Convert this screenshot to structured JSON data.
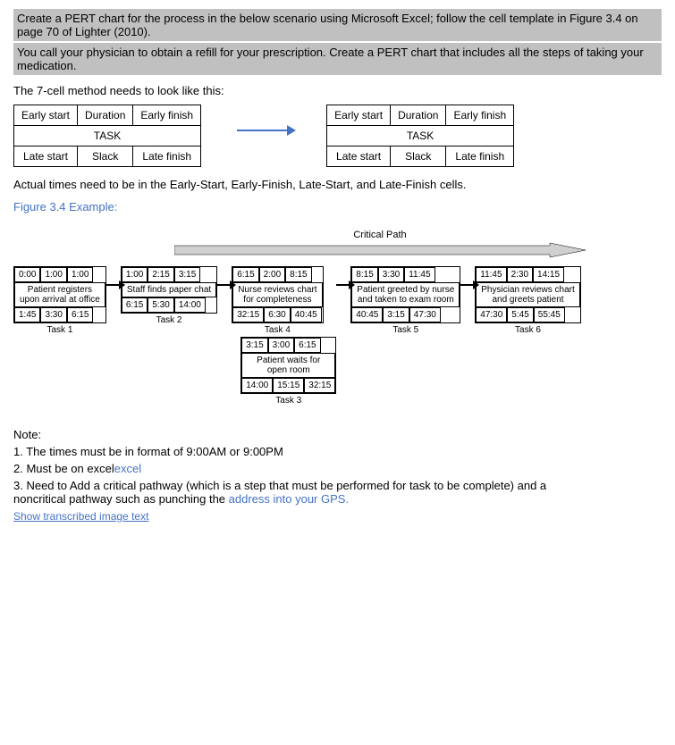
{
  "instructions": {
    "line1": "Create a PERT chart for the process in the below scenario using Microsoft Excel; follow the cell template in Figure 3.4 on page 70 of Lighter (2010).",
    "line2": "You call your physician to obtain a refill for your prescription. Create a PERT chart that includes all the steps of taking your medication."
  },
  "method_title": "The 7-cell method needs to look like this:",
  "left_table": {
    "top_row": [
      "Early start",
      "Duration",
      "Early finish"
    ],
    "middle": "TASK",
    "bottom_row": [
      "Late start",
      "Slack",
      "Late finish"
    ]
  },
  "right_table": {
    "top_row": [
      "Early start",
      "Duration",
      "Early finish"
    ],
    "middle": "TASK",
    "bottom_row": [
      "Late start",
      "Slack",
      "Late finish"
    ]
  },
  "actual_times_note": "Actual times need to be in the Early-Start, Early-Finish, Late-Start, and Late-Finish cells.",
  "figure_label": "Figure 3.4 Example:",
  "critical_path_label": "Critical Path",
  "tasks": [
    {
      "id": "task1",
      "label": "Task 1",
      "top": [
        "0:00",
        "1:00",
        "1:00"
      ],
      "middle": "Patient registers\nupon arrival at office",
      "bottom": [
        "1:45",
        "3:30",
        "6:15"
      ]
    },
    {
      "id": "task2",
      "label": "Task 2",
      "top": [
        "1:00",
        "2:15",
        "3:15"
      ],
      "middle": "Staff finds paper chat",
      "bottom": [
        "6:15",
        "5:30",
        "14:00"
      ]
    },
    {
      "id": "task3",
      "label": "Task 3",
      "top": [
        "3:15",
        "3:00",
        "6:15"
      ],
      "middle": "Patient waits for\nopen room",
      "bottom": [
        "14:00",
        "15:15",
        "32:15"
      ]
    },
    {
      "id": "task4",
      "label": "Task 4",
      "top": [
        "6:15",
        "2:00",
        "8:15"
      ],
      "middle": "Nurse reviews chart\nfor completeness",
      "bottom": [
        "32:15",
        "6:30",
        "40:45"
      ]
    },
    {
      "id": "task5",
      "label": "Task 5",
      "top": [
        "8:15",
        "3:30",
        "11:45"
      ],
      "middle": "Patient greeted by nurse\nand taken to exam room",
      "bottom": [
        "40:45",
        "3:15",
        "47:30"
      ]
    },
    {
      "id": "task6",
      "label": "Task 6",
      "top": [
        "11:45",
        "2:30",
        "14:15"
      ],
      "middle": "Physician reviews chart\nand greets patient",
      "bottom": [
        "47:30",
        "5:45",
        "55:45"
      ]
    }
  ],
  "notes": {
    "title": "Note:",
    "items": [
      "1. The times must be in format of 9:00AM or 9:00PM",
      "2. Must be on excel",
      "3. Need to Add a critical pathway (which is a step that must be performed for task to be complete) and a noncritical pathway such as punching the address into your GPS."
    ],
    "show_transcribed": "Show transcribed image text"
  }
}
